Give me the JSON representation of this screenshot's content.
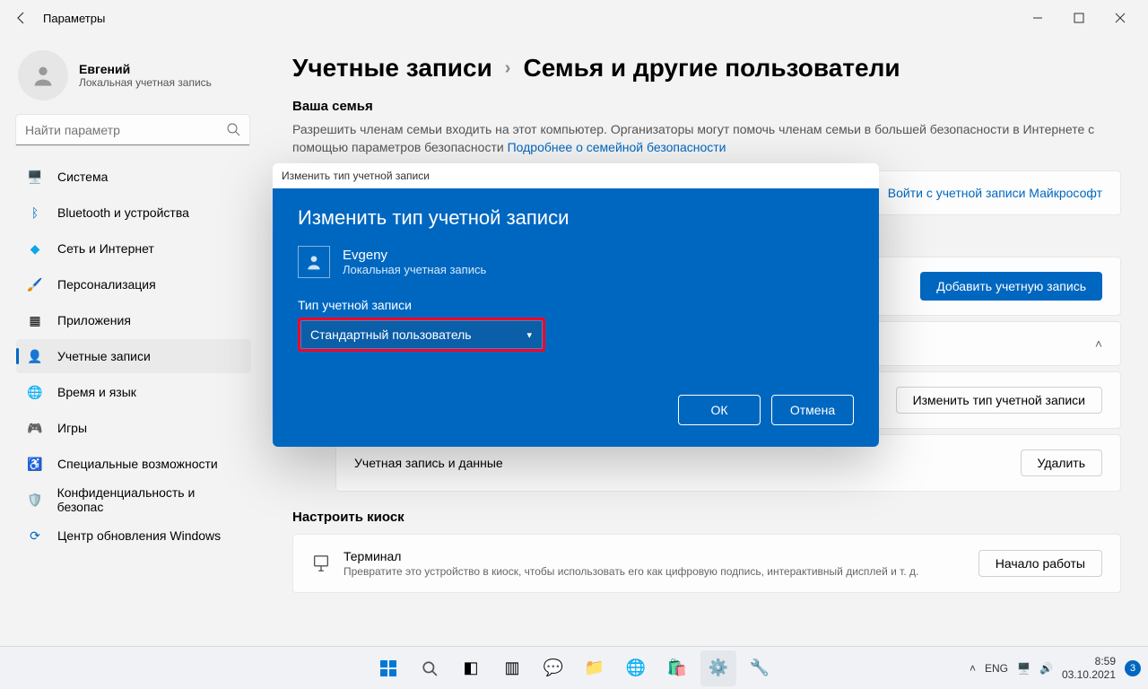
{
  "window": {
    "title": "Параметры"
  },
  "profile": {
    "name": "Евгений",
    "sub": "Локальная учетная запись"
  },
  "search": {
    "placeholder": "Найти параметр"
  },
  "nav": {
    "system": "Система",
    "bluetooth": "Bluetooth и устройства",
    "network": "Сеть и Интернет",
    "personal": "Персонализация",
    "apps": "Приложения",
    "accounts": "Учетные записи",
    "time": "Время и язык",
    "games": "Игры",
    "access": "Специальные возможности",
    "privacy": "Конфиденциальность и безопас",
    "update": "Центр обновления Windows"
  },
  "breadcrumb": {
    "root": "Учетные записи",
    "page": "Семья и другие пользователи"
  },
  "family": {
    "title": "Ваша семья",
    "desc1": "Разрешить членам семьи входить на этот компьютер. Организаторы могут помочь членам семьи в большей безопасности в Интернете с помощью параметров безопасности  ",
    "link": "Подробнее о семейной безопасности",
    "signin": "Войти с учетной записи Майкрософт"
  },
  "others": {
    "add": "Добавить учетную запись",
    "change": "Изменить тип учетной записи",
    "data_label": "Учетная запись и данные",
    "delete": "Удалить"
  },
  "kiosk": {
    "title": "Настроить киоск",
    "terminal": "Терминал",
    "terminal_desc": "Превратите это устройство в киоск, чтобы использовать его как цифровую подпись, интерактивный дисплей и т. д.",
    "start": "Начало работы"
  },
  "dialog": {
    "titlebar": "Изменить тип учетной записи",
    "heading": "Изменить тип учетной записи",
    "user_name": "Evgeny",
    "user_sub": "Локальная учетная запись",
    "type_label": "Тип учетной записи",
    "type_value": "Стандартный пользователь",
    "ok": "ОК",
    "cancel": "Отмена"
  },
  "taskbar": {
    "lang": "ENG",
    "time": "8:59",
    "date": "03.10.2021",
    "badge": "3"
  }
}
